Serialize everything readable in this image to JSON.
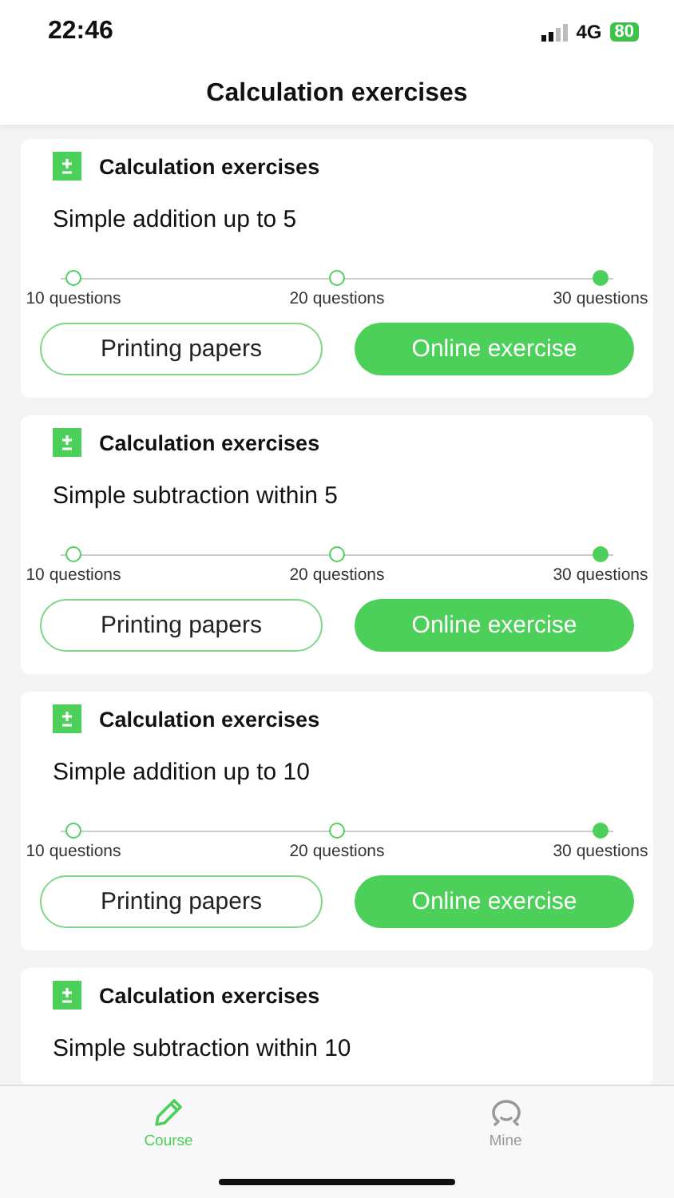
{
  "status_bar": {
    "time": "22:46",
    "network": "4G",
    "battery": "80"
  },
  "header": {
    "title": "Calculation exercises"
  },
  "cards": [
    {
      "category": "Calculation exercises",
      "title": "Simple addition up to 5",
      "options": [
        {
          "label": "10 questions",
          "selected": false
        },
        {
          "label": "20 questions",
          "selected": false
        },
        {
          "label": "30 questions",
          "selected": true
        }
      ],
      "buttons": [
        {
          "label": "Printing papers",
          "kind": "outline"
        },
        {
          "label": "Online exercise",
          "kind": "filled"
        }
      ]
    },
    {
      "category": "Calculation exercises",
      "title": "Simple subtraction within 5",
      "options": [
        {
          "label": "10 questions",
          "selected": false
        },
        {
          "label": "20 questions",
          "selected": false
        },
        {
          "label": "30 questions",
          "selected": true
        }
      ],
      "buttons": [
        {
          "label": "Printing papers",
          "kind": "outline"
        },
        {
          "label": "Online exercise",
          "kind": "filled"
        }
      ]
    },
    {
      "category": "Calculation exercises",
      "title": "Simple addition up to 10",
      "options": [
        {
          "label": "10 questions",
          "selected": false
        },
        {
          "label": "20 questions",
          "selected": false
        },
        {
          "label": "30 questions",
          "selected": true
        }
      ],
      "buttons": [
        {
          "label": "Printing papers",
          "kind": "outline"
        },
        {
          "label": "Online exercise",
          "kind": "filled"
        }
      ]
    },
    {
      "category": "Calculation exercises",
      "title": "Simple subtraction within 10"
    }
  ],
  "tab_bar": [
    {
      "label": "Course",
      "kind": "pencil",
      "selected": true
    },
    {
      "label": "Mine",
      "kind": "person",
      "selected": false
    }
  ]
}
